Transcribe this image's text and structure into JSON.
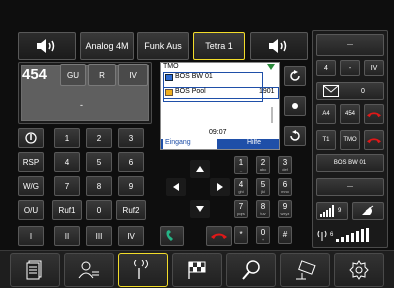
{
  "top_bar": {
    "volume_left_icon": "speaker-icon",
    "mode_analog": "Analog 4M",
    "mode_funk": "Funk Aus",
    "mode_tetra": "Tetra 1",
    "volume_right_icon": "speaker-icon"
  },
  "left_display": {
    "number": "454",
    "btn_gu": "GU",
    "btn_r": "R",
    "btn_iv": "IV",
    "status": "-"
  },
  "keypad": {
    "row1": [
      "1",
      "2",
      "3"
    ],
    "row2_label": "RSP",
    "row2": [
      "4",
      "5",
      "6"
    ],
    "row3_label": "W/G",
    "row3": [
      "7",
      "8",
      "9"
    ],
    "row4_label": "O/U",
    "row4": [
      "Ruf1",
      "0",
      "Ruf2"
    ],
    "row5": [
      "I",
      "II",
      "III",
      "IV"
    ]
  },
  "screen": {
    "network": "TMO",
    "item1": "BOS BW 01",
    "item2": "BOS Pool",
    "item2_value": "1901",
    "time": "09:07",
    "soft_left": "Eingang",
    "soft_right": "Hilfe"
  },
  "phone_keypad": [
    {
      "n": "1",
      "s": "_"
    },
    {
      "n": "2",
      "s": "abc"
    },
    {
      "n": "3",
      "s": "def"
    },
    {
      "n": "4",
      "s": "ghi"
    },
    {
      "n": "5",
      "s": "jkl"
    },
    {
      "n": "6",
      "s": "mno"
    },
    {
      "n": "7",
      "s": "pqrs"
    },
    {
      "n": "8",
      "s": "tuv"
    },
    {
      "n": "9",
      "s": "wxyz"
    },
    {
      "n": "*",
      "s": ""
    },
    {
      "n": "0",
      "s": "+"
    },
    {
      "n": "#",
      "s": ""
    }
  ],
  "right_panel": {
    "top_display": "---",
    "row1": [
      "4",
      "-",
      "IV"
    ],
    "envelope_count": "0",
    "a4": "A4",
    "num454": "454",
    "t1": "T1",
    "tmo": "TMO",
    "bos": "BOS BW 01",
    "dash": "---",
    "signal_count_a": "9",
    "signal_count_b": "6"
  },
  "colors": {
    "highlight": "#f2dc2a",
    "call_green": "#25b486",
    "hangup_red": "#e01818",
    "screen_blue": "#1f4fa8"
  },
  "bottom_nav": [
    {
      "icon": "document-icon"
    },
    {
      "icon": "contacts-icon"
    },
    {
      "icon": "antenna-icon"
    },
    {
      "icon": "race-flag-icon"
    },
    {
      "icon": "search-icon"
    },
    {
      "icon": "camera-icon"
    },
    {
      "icon": "settings-gear-icon"
    }
  ]
}
